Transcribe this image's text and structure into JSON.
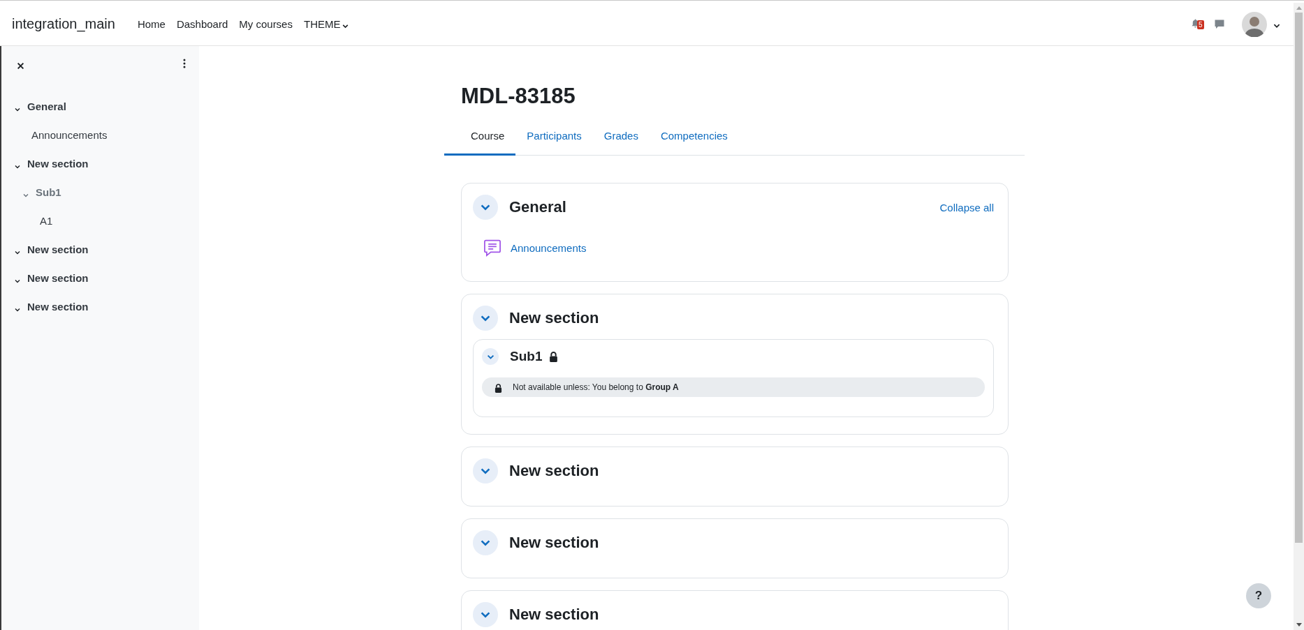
{
  "navbar": {
    "brand": "integration_main",
    "links": [
      {
        "label": "Home",
        "dropdown": false
      },
      {
        "label": "Dashboard",
        "dropdown": false
      },
      {
        "label": "My courses",
        "dropdown": false
      },
      {
        "label": "THEME",
        "dropdown": true
      }
    ],
    "notifications_badge": "5"
  },
  "sidebar": {
    "items": [
      {
        "label": "General",
        "kind": "section",
        "expanded": true,
        "children": [
          {
            "label": "Announcements",
            "kind": "activity"
          }
        ]
      },
      {
        "label": "New section",
        "kind": "section",
        "expanded": true,
        "children": [
          {
            "label": "Sub1",
            "kind": "subsection",
            "expanded": true,
            "children": [
              {
                "label": "A1",
                "kind": "activity"
              }
            ]
          }
        ]
      },
      {
        "label": "New section",
        "kind": "section",
        "expanded": true
      },
      {
        "label": "New section",
        "kind": "section",
        "expanded": true
      },
      {
        "label": "New section",
        "kind": "section",
        "expanded": true
      }
    ]
  },
  "page": {
    "title": "MDL-83185",
    "tabs": [
      {
        "label": "Course",
        "selected": true
      },
      {
        "label": "Participants",
        "selected": false
      },
      {
        "label": "Grades",
        "selected": false
      },
      {
        "label": "Competencies",
        "selected": false
      }
    ],
    "collapse_all": "Collapse all"
  },
  "sections": [
    {
      "title": "General",
      "expanded": true,
      "items": [
        {
          "kind": "activity",
          "label": "Announcements"
        }
      ]
    },
    {
      "title": "New section",
      "expanded": true,
      "items": [
        {
          "kind": "subsection",
          "title": "Sub1",
          "expanded": true,
          "locked": true,
          "restriction": "Not available unless: You belong to **Group A**"
        }
      ]
    },
    {
      "title": "New section",
      "expanded": true
    },
    {
      "title": "New section",
      "expanded": true
    },
    {
      "title": "New section",
      "expanded": true
    }
  ],
  "help_button": "?"
}
